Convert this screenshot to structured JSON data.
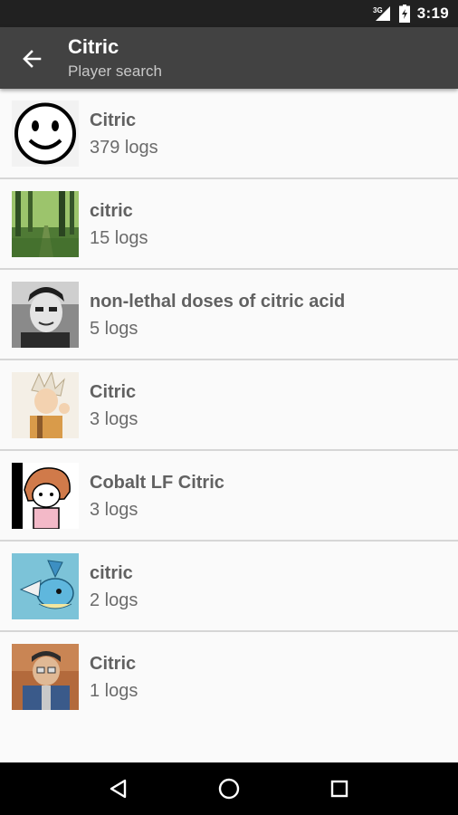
{
  "status_bar": {
    "network": "3G",
    "time": "3:19"
  },
  "app_bar": {
    "title": "Citric",
    "subtitle": "Player search",
    "back_icon": "arrow-left-icon"
  },
  "players": [
    {
      "name": "Citric",
      "logs": "379 logs",
      "avatar": "smiley-face"
    },
    {
      "name": "citric",
      "logs": "15 logs",
      "avatar": "forest-path"
    },
    {
      "name": "non-lethal doses of citric acid",
      "logs": "5 logs",
      "avatar": "bw-portrait"
    },
    {
      "name": "Citric",
      "logs": "3 logs",
      "avatar": "anime-character"
    },
    {
      "name": "Cobalt LF Citric",
      "logs": "3 logs",
      "avatar": "cartoon-girl"
    },
    {
      "name": "citric",
      "logs": "2 logs",
      "avatar": "vaporeon"
    },
    {
      "name": "Citric",
      "logs": "1 logs",
      "avatar": "tf2-medic"
    }
  ],
  "nav_bar": {
    "back": "triangle-back-icon",
    "home": "circle-home-icon",
    "recents": "square-recents-icon"
  },
  "colors": {
    "status_bar": "#212121",
    "app_bar": "#424242",
    "list_bg": "#fafafa",
    "nav_bar": "#000000"
  }
}
